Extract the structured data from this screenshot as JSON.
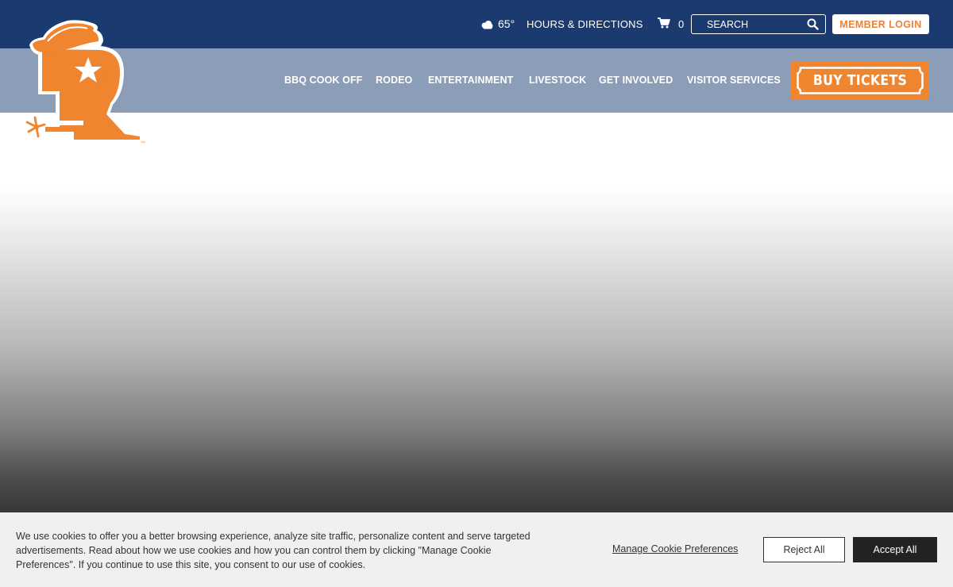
{
  "colors": {
    "top_bar": "#1b3a70",
    "nav_bar": "#8c9db8",
    "accent_orange": "#f0852f",
    "member_text": "#e8823a",
    "cookie_bg": "#f0f0f0"
  },
  "header": {
    "weather": {
      "icon": "cloudy-weather-icon",
      "temperature": "65°"
    },
    "hours_link": "HOURS & DIRECTIONS",
    "cart": {
      "icon": "shopping-cart-icon",
      "count": "0"
    },
    "search": {
      "placeholder": "SEARCH",
      "icon": "search-icon"
    },
    "member_login": "MEMBER LOGIN"
  },
  "logo": {
    "icon": "rodeo-r-cowboy-boot-logo",
    "mark": "™"
  },
  "nav": {
    "items": [
      {
        "label": "BBQ COOK OFF"
      },
      {
        "label": "RODEO"
      },
      {
        "label": "ENTERTAINMENT"
      },
      {
        "label": "LIVESTOCK"
      },
      {
        "label": "GET INVOLVED"
      },
      {
        "label": "VISITOR SERVICES"
      }
    ],
    "buy_tickets": "BUY TICKETS"
  },
  "cookie_banner": {
    "text": "We use cookies to offer you a better browsing experience, analyze site traffic, personalize content and serve targeted advertisements. Read about how we use cookies and how you can control them by clicking \"Manage Cookie Preferences\". If you continue to use this site, you consent to our use of cookies.",
    "manage": "Manage Cookie Preferences",
    "reject": "Reject All",
    "accept": "Accept All"
  }
}
